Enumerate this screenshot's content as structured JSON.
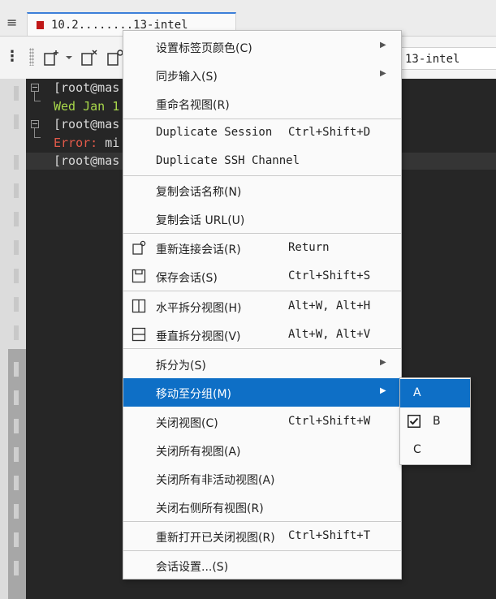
{
  "tab": {
    "title": "10.2........13-intel"
  },
  "address": {
    "text": "13-intel"
  },
  "terminal": {
    "lines": [
      {
        "parts": [
          {
            "text": "[root@mas",
            "color": "#d8d8d8"
          }
        ]
      },
      {
        "parts": [
          {
            "text": "Wed Jan 1",
            "color": "#a8d84a"
          }
        ]
      },
      {
        "parts": [
          {
            "text": "[root@mas",
            "color": "#d8d8d8"
          }
        ]
      },
      {
        "parts": [
          {
            "text": "Error:",
            "color": "#e25a4a"
          },
          {
            "text": " mi",
            "color": "#d8d8d8"
          }
        ]
      },
      {
        "parts": [
          {
            "text": "[root@mas",
            "color": "#d8d8d8"
          }
        ]
      }
    ]
  },
  "menu": {
    "items": [
      {
        "label": "设置标签页颜色(C)",
        "submenu": true
      },
      {
        "label": "同步输入(S)",
        "submenu": true
      },
      {
        "label": "重命名视图(R)"
      },
      {
        "label": "Duplicate Session",
        "shortcut": "Ctrl+Shift+D"
      },
      {
        "label": "Duplicate SSH Channel"
      },
      {
        "label": "复制会话名称(N)"
      },
      {
        "label": "复制会话 URL(U)"
      },
      {
        "label": "重新连接会话(R)",
        "shortcut": "Return",
        "icon": "reconnect-icon"
      },
      {
        "label": "保存会话(S)",
        "shortcut": "Ctrl+Shift+S",
        "icon": "save-icon"
      },
      {
        "label": "水平拆分视图(H)",
        "shortcut": "Alt+W, Alt+H",
        "icon": "split-horizontal-icon"
      },
      {
        "label": "垂直拆分视图(V)",
        "shortcut": "Alt+W, Alt+V",
        "icon": "split-vertical-icon"
      },
      {
        "label": "拆分为(S)",
        "submenu": true
      },
      {
        "label": "移动至分组(M)",
        "submenu": true,
        "highlighted": true
      },
      {
        "label": "关闭视图(C)",
        "shortcut": "Ctrl+Shift+W"
      },
      {
        "label": "关闭所有视图(A)"
      },
      {
        "label": "关闭所有非活动视图(A)"
      },
      {
        "label": "关闭右侧所有视图(R)"
      },
      {
        "label": "重新打开已关闭视图(R)",
        "shortcut": "Ctrl+Shift+T"
      },
      {
        "label": "会话设置...(S)"
      }
    ]
  },
  "submenu": {
    "items": [
      {
        "label": "A",
        "highlighted": true
      },
      {
        "label": "B",
        "checked": true
      },
      {
        "label": "C"
      }
    ]
  },
  "colors": {
    "highlight": "#0e6fc6",
    "tab_accent": "#3c7fd9",
    "terminal_bg": "#262626"
  }
}
